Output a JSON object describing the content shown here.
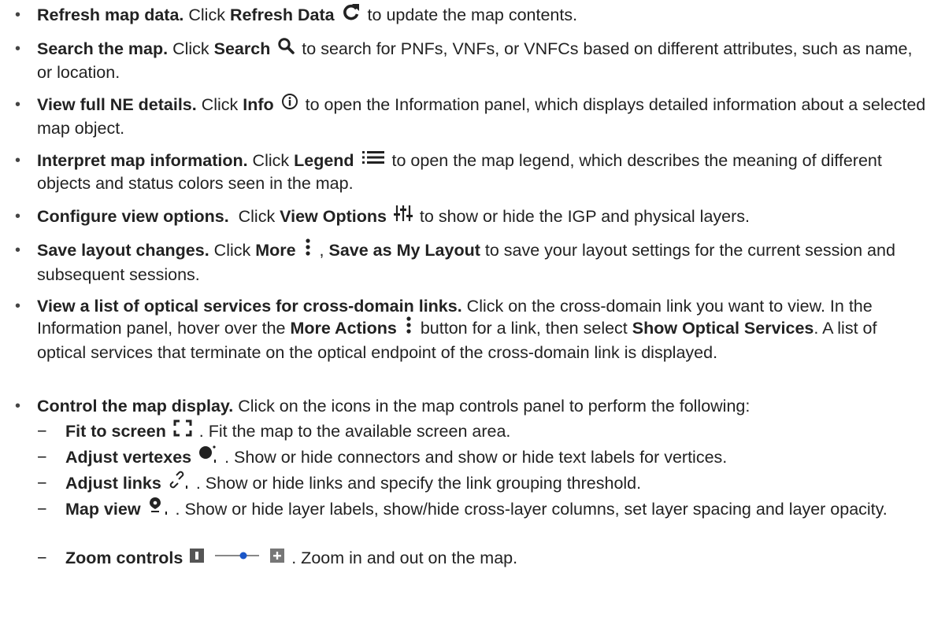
{
  "bullet": "•",
  "dash": "−",
  "items": [
    {
      "title": "Refresh map data.",
      "pre": " Click ",
      "name": "Refresh Data",
      "post": " to update the map contents."
    },
    {
      "title": "Search the map.",
      "pre": " Click ",
      "name": "Search",
      "post": " to search for PNFs, VNFs, or VNFCs based on different attributes, such as name, or location."
    },
    {
      "title": "View full NE details.",
      "pre": " Click ",
      "name": "Info",
      "post": " to open the Information panel, which displays detailed information about a selected map object."
    },
    {
      "title": "Interpret map information.",
      "pre": " Click ",
      "name": "Legend",
      "post": " to open the map legend, which describes the meaning of different objects and status colors seen in the map."
    },
    {
      "title": "Configure view options.",
      "pre": "  Click ",
      "name": "View Options",
      "post": " to show or hide the IGP and physical layers."
    },
    {
      "title": "Save layout changes.",
      "pre": " Click ",
      "name": "More",
      "mid": " , ",
      "name2": "Save as My Layout",
      "post": " to save your layout settings for the current session and subsequent sessions."
    },
    {
      "title": "View a list of optical services for cross-domain links.",
      "pre": " Click on the cross-domain link you want to view. In the Information panel, hover over the ",
      "name": "More Actions",
      "post": " button for a link, then select ",
      "name2": "Show Optical Services",
      "post2": ". A list of optical services that terminate on the optical endpoint of the cross-domain link is displayed."
    },
    {
      "title": "Control the map display.",
      "post": " Click on the icons in the map controls panel to perform the following:"
    }
  ],
  "subitems": [
    {
      "name": "Fit to screen",
      "post": " . Fit the map to the available screen area."
    },
    {
      "name": "Adjust vertexes",
      "post": " . Show or hide connectors and show or hide text labels for vertices."
    },
    {
      "name": "Adjust links",
      "post": " . Show or hide links and specify the link grouping threshold."
    },
    {
      "name": "Map view",
      "post": " . Show or hide layer labels, show/hide cross-layer columns, set layer spacing and layer opacity."
    },
    {
      "name": "Zoom controls",
      "post": " . Zoom in and out on the map."
    }
  ]
}
